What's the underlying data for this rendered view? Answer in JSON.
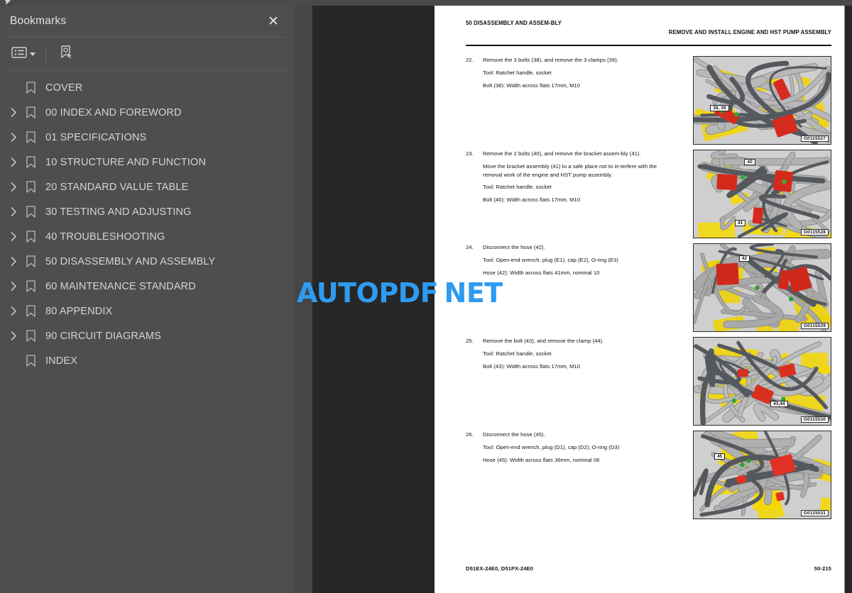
{
  "sidebar": {
    "title": "Bookmarks",
    "close_label": "✕",
    "toolbar": {
      "list_options_icon": "list-options-icon",
      "dropdown_caret": "chevron-down-icon",
      "new_bookmark_icon": "new-bookmark-icon"
    },
    "items": [
      {
        "label": "COVER",
        "expandable": false
      },
      {
        "label": "00 INDEX AND FOREWORD",
        "expandable": true
      },
      {
        "label": "01 SPECIFICATIONS",
        "expandable": true
      },
      {
        "label": "10 STRUCTURE AND FUNCTION",
        "expandable": true
      },
      {
        "label": "20 STANDARD VALUE TABLE",
        "expandable": true
      },
      {
        "label": "30 TESTING AND ADJUSTING",
        "expandable": true
      },
      {
        "label": "40 TROUBLESHOOTING",
        "expandable": true
      },
      {
        "label": "50 DISASSEMBLY AND ASSEMBLY",
        "expandable": true
      },
      {
        "label": "60 MAINTENANCE STANDARD",
        "expandable": true
      },
      {
        "label": "80 APPENDIX",
        "expandable": true
      },
      {
        "label": "90 CIRCUIT DIAGRAMS",
        "expandable": true
      },
      {
        "label": "INDEX",
        "expandable": false
      }
    ]
  },
  "document": {
    "header_left": "50 DISASSEMBLY AND ASSEM-BLY",
    "header_right": "REMOVE AND INSTALL ENGINE AND HST PUMP ASSEMBLY",
    "footer_left": "D51EX-24E0, D51PX-24E0",
    "footer_right": "50-215",
    "steps": [
      {
        "number": "22.",
        "paragraphs": [
          "Remove the 3 bolts (38), and remove the 3 clamps (39).",
          "Tool: Ratchet handle, socket",
          "Bolt (38): Width across flats 17mm, M10"
        ],
        "figure": {
          "caption": "G0115527",
          "callouts": [
            "38, 39"
          ]
        }
      },
      {
        "number": "23.",
        "paragraphs": [
          "Remove the 2 bolts (40), and remove the bracket assem-bly (41).",
          "Move the bracket assembly (41) to a safe place not to in-terfere with the removal work of the engine and HST pump assembly.",
          "Tool: Ratchet handle, socket",
          "Bolt (40): Width across flats 17mm, M10"
        ],
        "figure": {
          "caption": "G0115528",
          "callouts": [
            "40",
            "41"
          ]
        }
      },
      {
        "number": "24.",
        "paragraphs": [
          "Disconnect the hose (42).",
          "Tool: Open-end wrench, plug (E1), cap (E2), O-ring (E3)",
          "Hose (42): Width across flats 41mm, nominal 10"
        ],
        "figure": {
          "caption": "G0115529",
          "callouts": [
            "42"
          ]
        }
      },
      {
        "number": "25.",
        "paragraphs": [
          "Remove the bolt (43), and remove the clamp (44).",
          "Tool: Ratchet handle, socket",
          "Bolt (43): Width across flats 17mm, M10"
        ],
        "figure": {
          "caption": "G0115530",
          "callouts": [
            "43,44"
          ]
        }
      },
      {
        "number": "26.",
        "paragraphs": [
          "Disconnect the hose (45).",
          "Tool: Open-end wrench, plug (D1), cap (D2), O-ring (D3)",
          "Hose (45): Width across flats 36mm, nominal 06"
        ],
        "figure": {
          "caption": "G0115531",
          "callouts": [
            "45"
          ]
        }
      }
    ]
  },
  "watermark": {
    "part1": "AUTOPDF",
    "dot": ".",
    "part2": "NET"
  },
  "colors": {
    "sidebar_bg": "#4e4e4e",
    "viewer_bg": "#272727",
    "page_bg": "#ffffff",
    "watermark_blue": "#2e9bf0",
    "text_light": "#d4d4d4"
  }
}
